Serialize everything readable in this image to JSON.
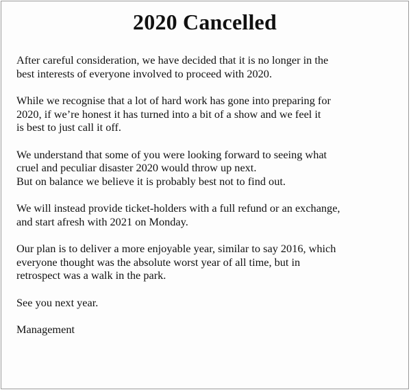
{
  "document": {
    "title": "2020 Cancelled",
    "paragraphs": [
      {
        "lines": [
          "After careful consideration, we have decided that it is no longer in the",
          "best interests of everyone involved to proceed with 2020."
        ]
      },
      {
        "lines": [
          "While we recognise that a lot of hard work has gone into preparing for",
          "2020, if we’re honest it has turned into a bit of a show and we feel it",
          "is best to just call it off."
        ]
      },
      {
        "lines": [
          "We understand that some of you were looking forward to seeing what",
          "cruel and peculiar disaster 2020 would throw up next.",
          "But on balance we believe it is probably best not to find out."
        ]
      },
      {
        "lines": [
          "We will instead provide ticket-holders with a full refund or an exchange,",
          "and start afresh with 2021 on Monday."
        ]
      },
      {
        "lines": [
          "Our plan is to deliver a more enjoyable year, similar to say 2016, which",
          "everyone thought was the absolute worst year of all time, but in",
          "retrospect was a walk in the park."
        ]
      },
      {
        "lines": [
          "See you next year."
        ]
      },
      {
        "lines": [
          "Management"
        ]
      }
    ]
  }
}
